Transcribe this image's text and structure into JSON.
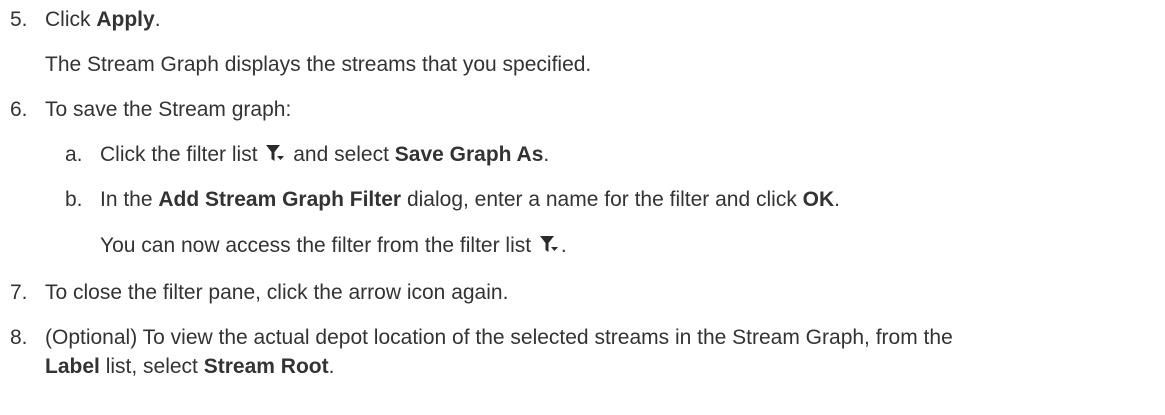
{
  "steps": {
    "s5": {
      "number": "5.",
      "text1": "Click ",
      "bold1": "Apply",
      "text2": ".",
      "result": "The Stream Graph displays the streams that you specified."
    },
    "s6": {
      "number": "6.",
      "text": "To save the Stream graph:",
      "a": {
        "marker": "a.",
        "text1": "Click the filter list ",
        "text2": " and select ",
        "bold1": "Save Graph As",
        "text3": "."
      },
      "b": {
        "marker": "b.",
        "text1": "In the ",
        "bold1": "Add Stream Graph Filter",
        "text2": " dialog, enter a name for the filter and click ",
        "bold2": "OK",
        "text3": ".",
        "result1": "You can now access the filter from the filter list ",
        "result2": "."
      }
    },
    "s7": {
      "number": "7.",
      "text": "To close the filter pane, click the arrow icon again."
    },
    "s8": {
      "number": "8.",
      "text1": "(Optional) To view the actual depot location of the selected streams in the Stream Graph, from the",
      "bold1": "Label",
      "text2": " list, select ",
      "bold2": "Stream Root",
      "text3": "."
    }
  },
  "icons": {
    "filter": "filter-dropdown-icon"
  },
  "colors": {
    "text": "#333333",
    "icon": "#2b2b2b"
  }
}
